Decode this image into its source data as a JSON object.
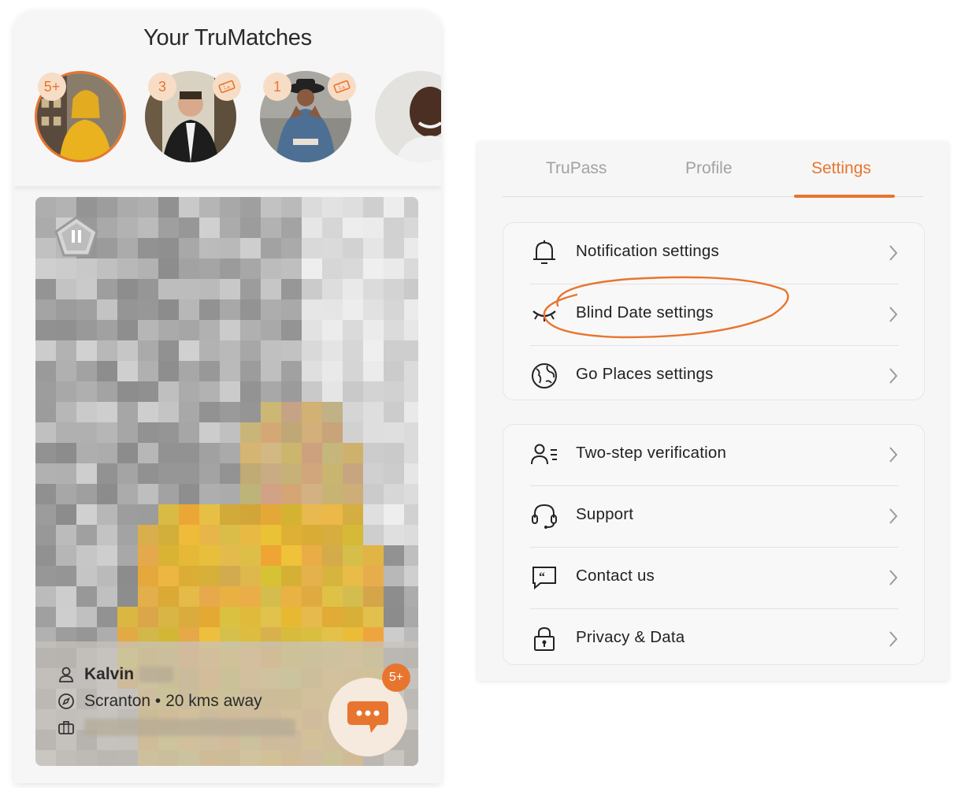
{
  "matches": {
    "title": "Your TruMatches",
    "items": [
      {
        "name": "match-1",
        "count": "5+",
        "ticket": false,
        "selected": true
      },
      {
        "name": "match-2",
        "count": "3",
        "ticket": true,
        "selected": false
      },
      {
        "name": "match-3",
        "count": "1",
        "ticket": true,
        "selected": false
      },
      {
        "name": "match-4",
        "count": "",
        "ticket": false,
        "selected": false
      }
    ]
  },
  "card": {
    "name": "Kalvin",
    "location": "Scranton • 20 kms away",
    "chat_badge": "5+"
  },
  "settings": {
    "tabs": [
      {
        "label": "TruPass",
        "active": false
      },
      {
        "label": "Profile",
        "active": false
      },
      {
        "label": "Settings",
        "active": true
      }
    ],
    "group1": [
      {
        "label": "Notification settings",
        "icon": "bell-icon"
      },
      {
        "label": "Blind Date settings",
        "icon": "closed-eye-icon"
      },
      {
        "label": "Go Places settings",
        "icon": "globe-icon"
      }
    ],
    "group2": [
      {
        "label": "Two-step verification",
        "icon": "user-list-icon"
      },
      {
        "label": "Support",
        "icon": "headset-icon"
      },
      {
        "label": "Contact us",
        "icon": "quote-bubble-icon"
      },
      {
        "label": "Privacy & Data",
        "icon": "lock-icon"
      }
    ]
  },
  "colors": {
    "accent": "#e8752f",
    "badge_bg": "#f8ddc6",
    "panel_bg": "#f6f6f6"
  }
}
